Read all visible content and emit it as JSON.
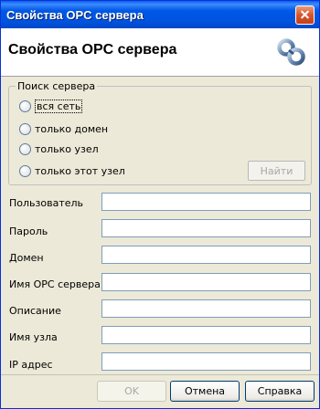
{
  "window": {
    "title": "Свойства OPC сервера"
  },
  "header": {
    "title": "Свойства OPC сервера",
    "icon": "link-chain-icon"
  },
  "search": {
    "group_label": "Поиск сервера",
    "options": [
      {
        "label": "вся сеть",
        "selected": false
      },
      {
        "label": "только домен",
        "selected": false
      },
      {
        "label": "только узел",
        "selected": false
      },
      {
        "label": "только этот узел",
        "selected": false
      }
    ],
    "find_label": "Найти"
  },
  "fields": [
    {
      "label": "Пользователь",
      "value": ""
    },
    {
      "label": "Пароль",
      "value": ""
    },
    {
      "label": "Домен",
      "value": ""
    },
    {
      "label": "Имя OPC сервера",
      "value": ""
    },
    {
      "label": "Описание",
      "value": ""
    },
    {
      "label": "Имя узла",
      "value": ""
    },
    {
      "label": "IP адрес",
      "value": ""
    }
  ],
  "buttons": {
    "ok_label": "OK",
    "cancel_label": "Отмена",
    "help_label": "Справка"
  },
  "colors": {
    "titlebar": "#0054e3",
    "dialog_bg": "#ece9d8",
    "input_border": "#7f9db9"
  }
}
